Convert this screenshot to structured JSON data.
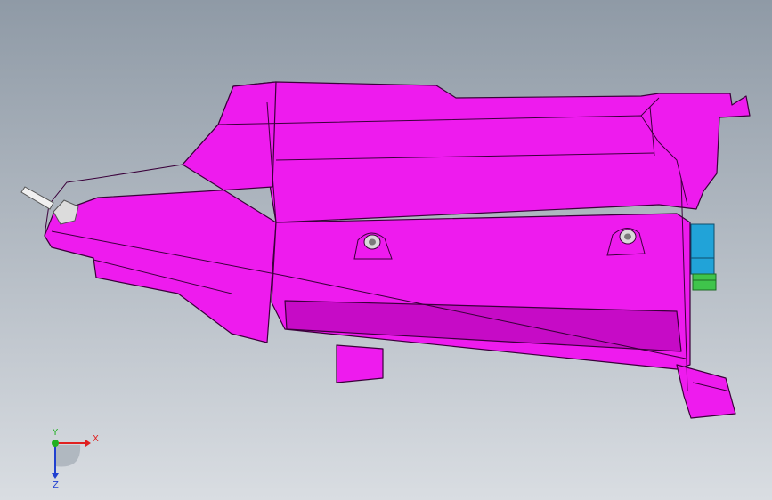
{
  "viewport": {
    "background_top": "#8f9aa6",
    "background_bottom": "#d9dde2"
  },
  "model": {
    "body_color": "#ee1bee",
    "shade_color": "#c60bc6",
    "edge_color": "#3a003a",
    "connector_blue": "#21a3d8",
    "connector_green": "#3fc44b"
  },
  "triad": {
    "x_label": "X",
    "y_label": "Y",
    "z_label": "Z",
    "x_color": "#e02020",
    "y_color": "#20b020",
    "z_color": "#2040d0"
  }
}
